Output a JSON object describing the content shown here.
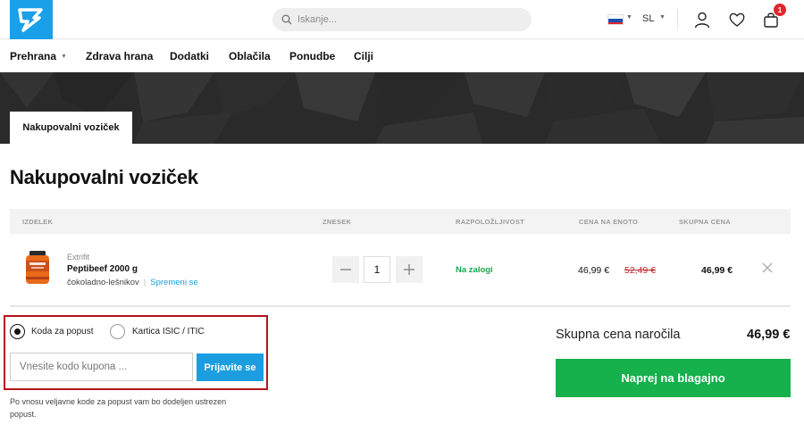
{
  "header": {
    "search_placeholder": "Iskanje...",
    "language": "SL",
    "cart_count": "1"
  },
  "nav": {
    "items": [
      "Prehrana",
      "Zdrava hrana",
      "Dodatki",
      "Oblačila",
      "Ponudbe",
      "Cilji"
    ]
  },
  "banner": {
    "tab_label": "Nakupovalni voziček"
  },
  "page": {
    "title": "Nakupovalni voziček"
  },
  "table": {
    "headers": [
      "IZDELEK",
      "ZNESEK",
      "RAZPOLOŽLJIVOST",
      "CENA NA ENOTO",
      "SKUPNA CENA"
    ],
    "rows": [
      {
        "brand": "Extrifit",
        "name": "Peptibeef 2000 g",
        "variant": "čokoladno-lešnikov",
        "change_label": "Spremeni se",
        "quantity": "1",
        "availability": "Na zalogi",
        "price": "46,99 €",
        "old_price": "52,49 €",
        "total": "46,99 €"
      }
    ]
  },
  "coupon": {
    "option_code": "Koda za popust",
    "option_card": "Kartica ISIC / ITIC",
    "input_placeholder": "Vnesite kodo kupona ...",
    "apply_label": "Prijavite se",
    "note": "Po vnosu veljavne kode za popust vam bo dodeljen ustrezen popust."
  },
  "summary": {
    "label": "Skupna cena naročila",
    "value": "46,99 €",
    "checkout_label": "Naprej na blagajno"
  },
  "colors": {
    "brand": "#1aa0e8",
    "checkout": "#16b04d",
    "stock": "#17a84a",
    "old_price": "#c0272d",
    "highlight_border": "#b3151c",
    "badge": "#e0262d"
  }
}
